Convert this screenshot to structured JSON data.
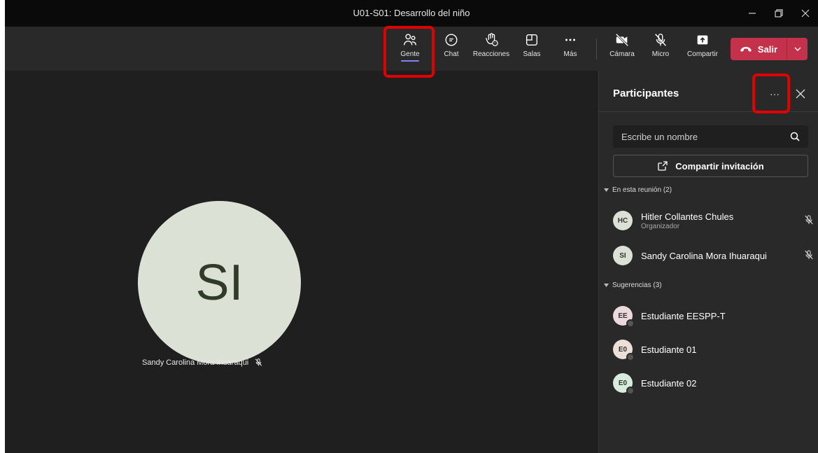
{
  "window": {
    "title": "U01-S01: Desarrollo del niño"
  },
  "toolbar": {
    "buttons": {
      "people": "Gente",
      "chat": "Chat",
      "reactions": "Reacciones",
      "rooms": "Salas",
      "more": "Más",
      "camera": "Cámara",
      "mic": "Micro",
      "share": "Compartir"
    },
    "leave": "Salir"
  },
  "stage": {
    "initials": "SI",
    "participant_name": "Sandy Carolina Mora Ihuaraqui"
  },
  "panel": {
    "title": "Participantes",
    "more": "···",
    "search_placeholder": "Escribe un nombre",
    "share_invite": "Compartir invitación",
    "in_meeting_label": "En esta reunión (2)",
    "in_meeting": [
      {
        "initials": "HC",
        "name": "Hitler Collantes Chules",
        "role": "Organizador",
        "avatar_color": "#dbe2d5"
      },
      {
        "initials": "SI",
        "name": "Sandy Carolina Mora Ihuaraqui",
        "avatar_color": "#dbe2d5"
      }
    ],
    "suggestions_label": "Sugerencias (3)",
    "suggestions": [
      {
        "initials": "EE",
        "name": "Estudiante EESPP-T",
        "avatar_color": "#ecd9dc"
      },
      {
        "initials": "E0",
        "name": "Estudiante 01",
        "avatar_color": "#ecdfd8"
      },
      {
        "initials": "E0",
        "name": "Estudiante 02",
        "avatar_color": "#d8ecdb"
      }
    ]
  },
  "colors": {
    "leave_button": "#c4314b",
    "accent": "#7f85f5",
    "highlight": "#e10000"
  }
}
